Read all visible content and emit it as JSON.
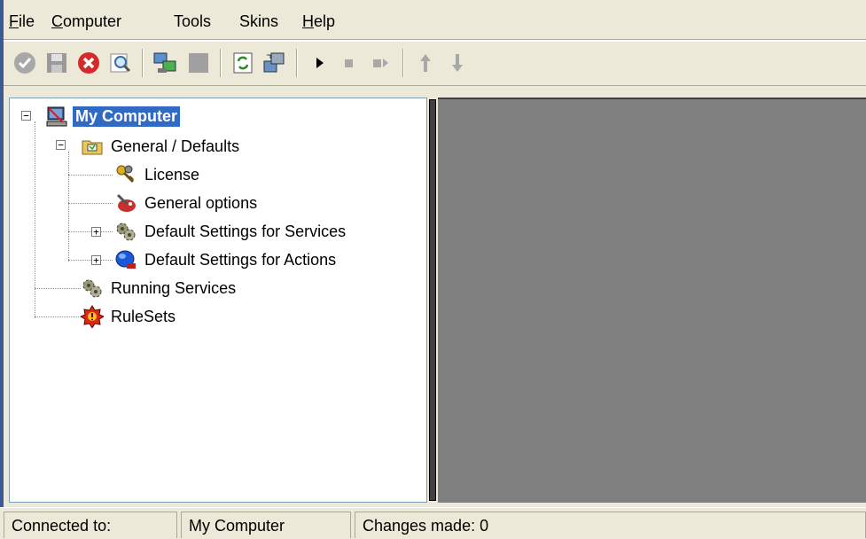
{
  "menu": {
    "file": {
      "underline": "F",
      "rest": "ile"
    },
    "computer": {
      "underline": "C",
      "rest": "omputer"
    },
    "tools": {
      "label": "Tools"
    },
    "skins": {
      "label": "Skins"
    },
    "help": {
      "underline": "H",
      "rest": "elp"
    }
  },
  "toolbar": {
    "icons": [
      "check-icon",
      "save-icon",
      "delete-icon",
      "find-icon",
      "connect-icon",
      "disconnect-icon",
      "refresh-icon",
      "services-icon",
      "play-icon",
      "stop-icon",
      "step-icon",
      "move-up-icon",
      "move-down-icon"
    ]
  },
  "tree": {
    "root": "My Computer",
    "general": "General / Defaults",
    "license": "License",
    "general_options": "General options",
    "default_services": "Default Settings for Services",
    "default_actions": "Default Settings for Actions",
    "running_services": "Running Services",
    "rulesets": "RuleSets"
  },
  "status": {
    "connected_label": "Connected to:",
    "computer": "My Computer",
    "changes": "Changes made: 0"
  },
  "colors": {
    "selection": "#316ac5",
    "pane_gray": "#808080",
    "window_bg": "#ece9d8"
  }
}
